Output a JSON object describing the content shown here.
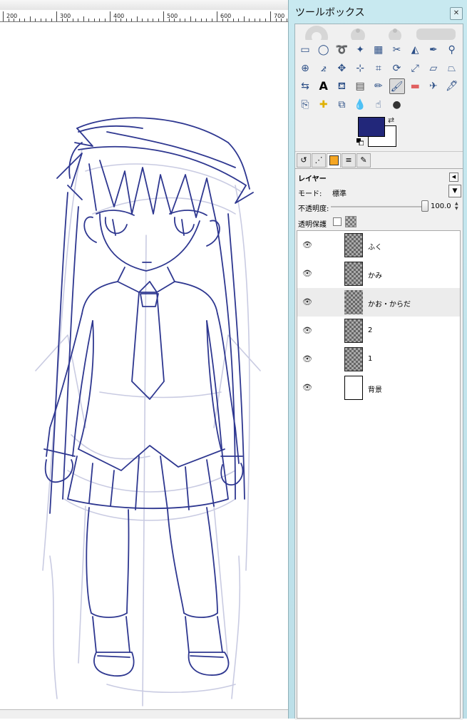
{
  "canvas": {
    "ruler_labels": [
      "200",
      "300",
      "400",
      "500",
      "600",
      "700"
    ],
    "line_color": "#2e3790"
  },
  "toolbox": {
    "title": "ツールボックス",
    "close_icon": "close-icon",
    "tools": [
      "rect-select-icon",
      "ellipse-select-icon",
      "free-select-icon",
      "fuzzy-select-icon",
      "color-select-icon",
      "scissors-select-icon",
      "foreground-select-icon",
      "paths-icon",
      "color-picker-icon",
      "zoom-icon",
      "measure-icon",
      "move-icon",
      "align-icon",
      "crop-icon",
      "rotate-icon",
      "scale-icon",
      "shear-icon",
      "perspective-icon",
      "flip-icon",
      "text-icon",
      "bucket-fill-icon",
      "blend-icon",
      "pencil-icon",
      "paintbrush-icon",
      "eraser-icon",
      "airbrush-icon",
      "ink-icon",
      "clone-icon",
      "heal-icon",
      "perspective-clone-icon",
      "blur-icon",
      "smudge-icon",
      "dodge-burn-icon"
    ],
    "active_tool": "paintbrush-icon",
    "foreground_color": "#22277a",
    "background_color": "#ffffff"
  },
  "dock": {
    "tabs": [
      "tool-options-icon",
      "device-status-icon",
      "layers-tab-icon",
      "channels-icon",
      "paths-tab-icon"
    ]
  },
  "layers": {
    "title": "レイヤー",
    "mode_label": "モード:",
    "mode_value": "標準",
    "opacity_label": "不透明度:",
    "opacity_value": "100.0",
    "lock_label": "透明保護",
    "items": [
      {
        "name": "ふく",
        "selected": false
      },
      {
        "name": "かみ",
        "selected": false
      },
      {
        "name": "かお・からだ",
        "selected": true
      },
      {
        "name": "2",
        "selected": false
      },
      {
        "name": "1",
        "selected": false
      },
      {
        "name": "背景",
        "selected": false
      }
    ]
  }
}
